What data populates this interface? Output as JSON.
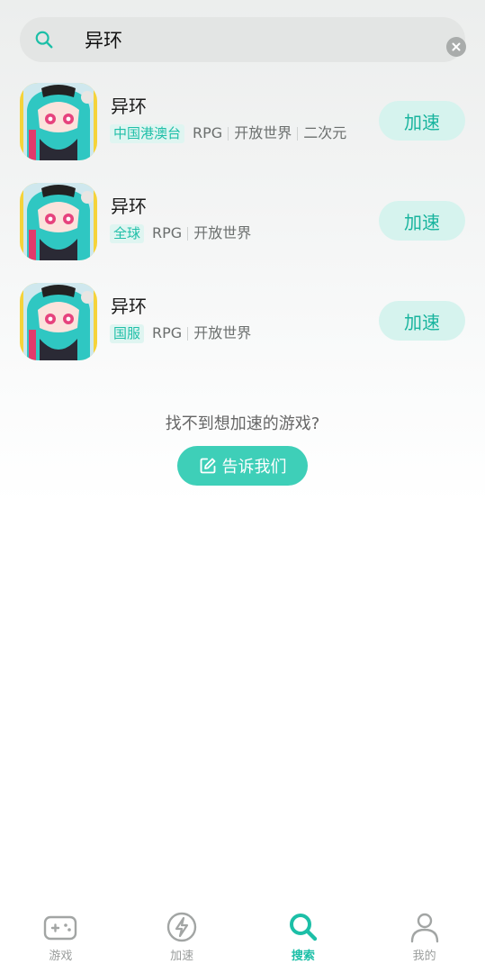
{
  "search": {
    "value": "异环",
    "placeholder": ""
  },
  "results": [
    {
      "name": "异环",
      "region": "中国港澳台",
      "tags": [
        "RPG",
        "开放世界",
        "二次元"
      ],
      "button": "加速"
    },
    {
      "name": "异环",
      "region": "全球",
      "tags": [
        "RPG",
        "开放世界"
      ],
      "button": "加速"
    },
    {
      "name": "异环",
      "region": "国服",
      "tags": [
        "RPG",
        "开放世界"
      ],
      "button": "加速"
    }
  ],
  "not_found": {
    "text": "找不到想加速的游戏?",
    "button": "告诉我们"
  },
  "tabbar": {
    "items": [
      {
        "label": "游戏",
        "icon": "gamepad-icon",
        "active": false
      },
      {
        "label": "加速",
        "icon": "lightning-icon",
        "active": false
      },
      {
        "label": "搜索",
        "icon": "search-icon",
        "active": true
      },
      {
        "label": "我的",
        "icon": "person-icon",
        "active": false
      }
    ]
  },
  "colors": {
    "accent": "#1cbfa7",
    "accent_light": "#d6f3ee",
    "button_teal": "#3ecfb8"
  }
}
